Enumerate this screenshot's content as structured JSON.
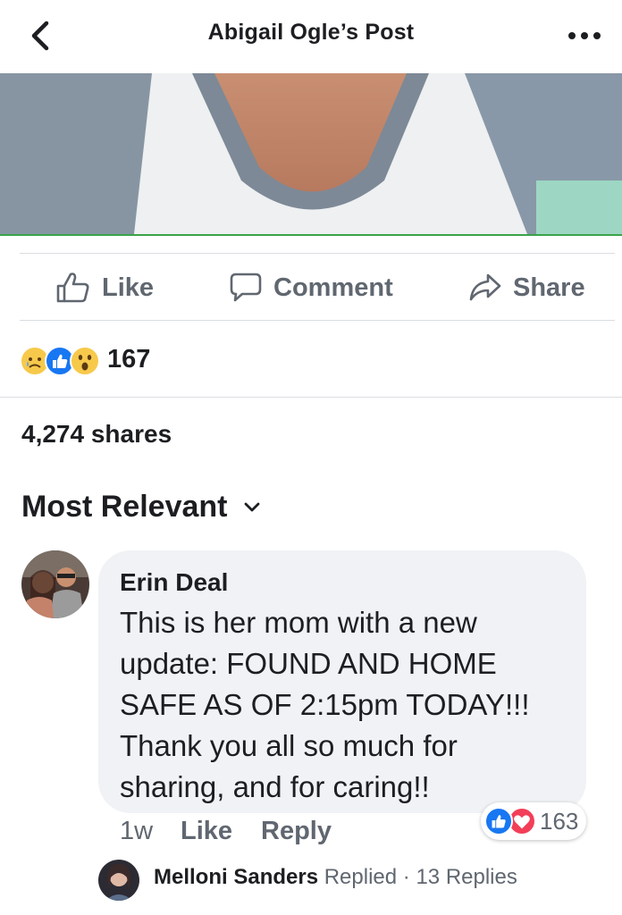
{
  "header": {
    "title": "Abigail Ogle’s Post",
    "back_icon": "chevron-left-icon",
    "more_icon": "more-dots-icon"
  },
  "actions": {
    "like_label": "Like",
    "comment_label": "Comment",
    "share_label": "Share"
  },
  "reactions": {
    "icons": [
      "sad-reaction-icon",
      "like-reaction-icon",
      "wow-reaction-icon"
    ],
    "count": "167"
  },
  "shares": {
    "label": "4,274 shares"
  },
  "comments_sort": {
    "label": "Most Relevant",
    "icon": "chevron-down-icon"
  },
  "comment": {
    "author": "Erin Deal",
    "text_lines": [
      "This is her mom with a new",
      "update: FOUND AND HOME",
      "SAFE AS OF 2:15pm TODAY!!!",
      "Thank you all so much for",
      "sharing, and for caring!!"
    ],
    "time": "1w",
    "like_label": "Like",
    "reply_label": "Reply",
    "reaction_icons": [
      "like-reaction-icon",
      "love-reaction-icon"
    ],
    "reaction_count": "163"
  },
  "reply_preview": {
    "name": "Melloni Sanders",
    "action": "Replied",
    "separator": "·",
    "replies": "13 Replies"
  },
  "colors": {
    "accent_blue": "#1877f2",
    "love_red": "#f33e58",
    "text_primary": "#1c1e21",
    "text_secondary": "#606770",
    "bubble_bg": "#f0f2f5",
    "reaction_yellow": "#f7c94b"
  }
}
